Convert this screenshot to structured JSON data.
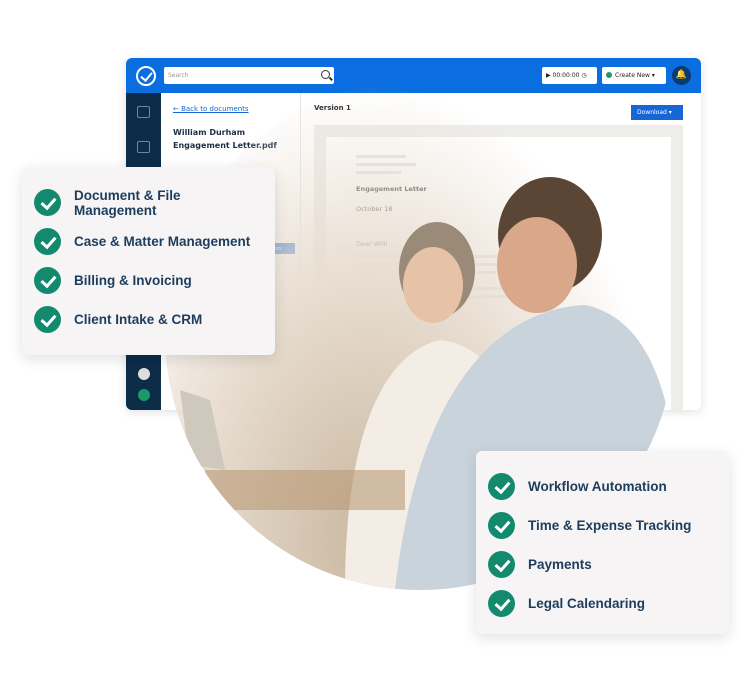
{
  "app": {
    "search_placeholder": "Search",
    "timer": "▶ 00:00:00 ◷",
    "create_new": "Create New ▾",
    "back_link": "← Back to documents",
    "file_name": "William Durham Engagement Letter.pdf",
    "version_button": "Version",
    "version_title": "Version 1",
    "download": "Download ▾",
    "letter": {
      "title": "Engagement Letter",
      "date": "October 18",
      "greeting": "Dear Willi"
    }
  },
  "features_left": [
    "Document & File Management",
    "Case & Matter Management",
    "Billing & Invoicing",
    "Client Intake & CRM"
  ],
  "features_right": [
    "Workflow Automation",
    "Time & Expense Tracking",
    "Payments",
    "Legal Calendaring"
  ],
  "colors": {
    "brand_blue": "#0a6ee0",
    "sidebar": "#0d2c48",
    "check_green": "#138a6e",
    "feature_text": "#1e3d5c"
  }
}
